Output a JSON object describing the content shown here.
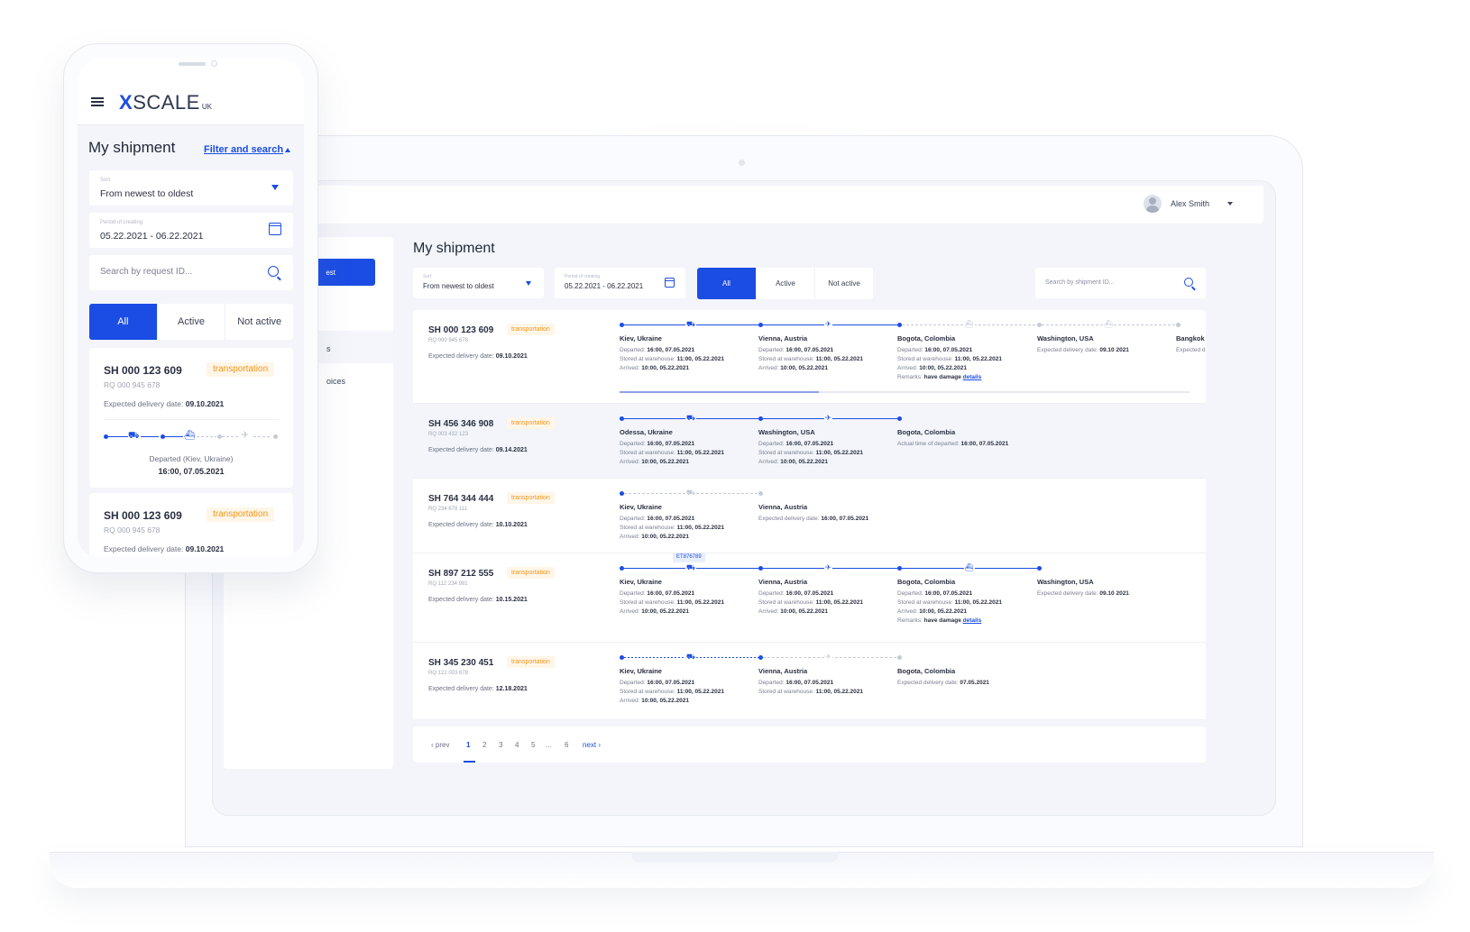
{
  "desktop": {
    "user": {
      "name": "Alex Smith"
    },
    "sidebar": {
      "button_label": "est",
      "item1": "s",
      "item2": "oices"
    },
    "title": "My shipment",
    "sort": {
      "label": "Sort",
      "value": "From newest to oldest"
    },
    "period": {
      "label": "Period of creating",
      "value": "05.22.2021 - 06.22.2021"
    },
    "tabs": [
      "All",
      "Active",
      "Not active"
    ],
    "search": {
      "placeholder": "Search by shipment ID..."
    },
    "shipments": [
      {
        "id": "SH 000 123 609",
        "status": "transportation",
        "rq": "RQ 000 945 678",
        "edd_label": "Expected delivery date:",
        "edd": "09.10.2021",
        "stops": [
          {
            "name": "Kiev, Ukraine",
            "lines": [
              [
                "Departed:",
                "16:00, 07.05.2021"
              ],
              [
                "Stored at warehouse:",
                "11:00, 05.22.2021"
              ],
              [
                "Arrived:",
                "10:00, 05.22.2021"
              ]
            ]
          },
          {
            "name": "Vienna, Austria",
            "lines": [
              [
                "Departed:",
                "16:00, 07.05.2021"
              ],
              [
                "Stored at warehouse:",
                "11:00, 05.22.2021"
              ],
              [
                "Arrived:",
                "10:00, 05.22.2021"
              ]
            ]
          },
          {
            "name": "Bogota, Colombia",
            "lines": [
              [
                "Departed:",
                "16:00, 07.05.2021"
              ],
              [
                "Stored at warehouse:",
                "11:00, 05.22.2021"
              ],
              [
                "Arrived:",
                "10:00, 05.22.2021"
              ],
              [
                "Remarks:",
                "have damage"
              ]
            ],
            "link": "details"
          },
          {
            "name": "Washington, USA",
            "lines": [
              [
                "Expected delivery date:",
                "09.10 2021"
              ]
            ]
          },
          {
            "name": "Bangkok",
            "lines": [
              [
                "Expected d",
                ""
              ]
            ]
          }
        ]
      },
      {
        "id": "SH 456 346 908",
        "status": "transportation",
        "rq": "RQ 003 432 123",
        "edd_label": "Expected delivery date:",
        "edd": "09.14.2021",
        "stops": [
          {
            "name": "Odessa, Ukraine",
            "lines": [
              [
                "Departed:",
                "16:00, 07.05.2021"
              ],
              [
                "Stored at warehouse:",
                "11:00, 05.22.2021"
              ],
              [
                "Arrived:",
                "10:00, 05.22.2021"
              ]
            ]
          },
          {
            "name": "Washington, USA",
            "lines": [
              [
                "Departed:",
                "16:00, 07.05.2021"
              ],
              [
                "Stored at warehouse:",
                "11:00, 05.22.2021"
              ],
              [
                "Arrived:",
                "10:00, 05.22.2021"
              ]
            ]
          },
          {
            "name": "Bogota, Colombia",
            "lines": [
              [
                "Actual time of departed:",
                "16:00, 07.05.2021"
              ]
            ]
          }
        ]
      },
      {
        "id": "SH 764 344 444",
        "status": "transportation",
        "rq": "RQ 234 678 111",
        "edd_label": "Expected delivery date:",
        "edd": "10.10.2021",
        "stops": [
          {
            "name": "Kiev, Ukraine",
            "lines": [
              [
                "Departed:",
                "16:00, 07.05.2021"
              ],
              [
                "Stored at warehouse:",
                "11:00, 05.22.2021"
              ],
              [
                "Arrived:",
                "10:00, 05.22.2021"
              ]
            ]
          },
          {
            "name": "Vienna, Austria",
            "lines": [
              [
                "Expected delivery date:",
                "16:00, 07.05.2021"
              ]
            ]
          }
        ]
      },
      {
        "id": "SH 897 212 555",
        "status": "transportation",
        "rq": "RQ 112 234 991",
        "edd_label": "Expected delivery date:",
        "edd": "10.15.2021",
        "tooltip": "ET876789",
        "stops": [
          {
            "name": "Kiev, Ukraine",
            "lines": [
              [
                "Departed:",
                "16:00, 07.05.2021"
              ],
              [
                "Stored at warehouse:",
                "11:00, 05.22.2021"
              ],
              [
                "Arrived:",
                "10:00, 05.22.2021"
              ]
            ]
          },
          {
            "name": "Vienna, Austria",
            "lines": [
              [
                "Departed:",
                "16:00, 07.05.2021"
              ],
              [
                "Stored at warehouse:",
                "11:00, 05.22.2021"
              ],
              [
                "Arrived:",
                "10:00, 05.22.2021"
              ]
            ]
          },
          {
            "name": "Bogota, Colombia",
            "lines": [
              [
                "Departed:",
                "16:00, 07.05.2021"
              ],
              [
                "Stored at warehouse:",
                "11:00, 05.22.2021"
              ],
              [
                "Arrived:",
                "10:00, 05.22.2021"
              ],
              [
                "Remarks:",
                "have damage"
              ]
            ],
            "link": "details"
          },
          {
            "name": "Washington, USA",
            "lines": [
              [
                "Expected delivery date:",
                "09.10 2021"
              ]
            ]
          }
        ]
      },
      {
        "id": "SH 345 230 451",
        "status": "transportation",
        "rq": "RQ 122 003 678",
        "edd_label": "Expected delivery date:",
        "edd": "12.18.2021",
        "stops": [
          {
            "name": "Kiev, Ukraine",
            "lines": [
              [
                "Departed:",
                "16:00, 07.05.2021"
              ],
              [
                "Stored at warehouse:",
                "11:00, 05.22.2021"
              ],
              [
                "Arrived:",
                "10:00, 05.22.2021"
              ]
            ]
          },
          {
            "name": "Vienna, Austria",
            "lines": [
              [
                "Departed:",
                "16:00, 07.05.2021"
              ],
              [
                "Stored at warehouse:",
                "11:00, 05.22.2021"
              ]
            ]
          },
          {
            "name": "Bogota, Colombia",
            "lines": [
              [
                "Expected delivery date:",
                "07.05.2021"
              ]
            ]
          }
        ]
      }
    ],
    "pagination": {
      "prev": "‹ prev",
      "pages": [
        "1",
        "2",
        "3",
        "4",
        "5",
        "...",
        "6"
      ],
      "current": "1",
      "next": "next ›"
    }
  },
  "mobile": {
    "logo": {
      "main_x": "X",
      "main_rest": "SCALE",
      "sub": "UK"
    },
    "title": "My shipment",
    "filter_link": "Filter and search",
    "sort": {
      "label": "Sort",
      "value": "From newest to oldest"
    },
    "period": {
      "label": "Period of creating",
      "value": "05.22.2021 - 06.22.2021"
    },
    "search": {
      "placeholder": "Search by request ID..."
    },
    "tabs": [
      "All",
      "Active",
      "Not active"
    ],
    "cards": [
      {
        "id": "SH 000 123 609",
        "status": "transportation",
        "rq": "RQ 000 945 678",
        "edd_label": "Expected delivery date:",
        "edd": "09.10.2021",
        "departed": "Departed (Kiev, Ukraine)",
        "departed_time": "16:00, 07.05.2021"
      },
      {
        "id": "SH 000 123 609",
        "status": "transportation",
        "rq": "RQ 000 945 678",
        "edd_label": "Expected delivery date:",
        "edd": "09.10.2021"
      }
    ]
  },
  "colors": {
    "accent": "#1b4de4",
    "status_tag": "#f0961c",
    "status_tag_bg": "#fff6e8"
  },
  "icons": [
    "menu-icon",
    "calendar-icon",
    "search-icon",
    "truck-icon",
    "plane-icon",
    "ship-icon",
    "cursor-icon"
  ]
}
